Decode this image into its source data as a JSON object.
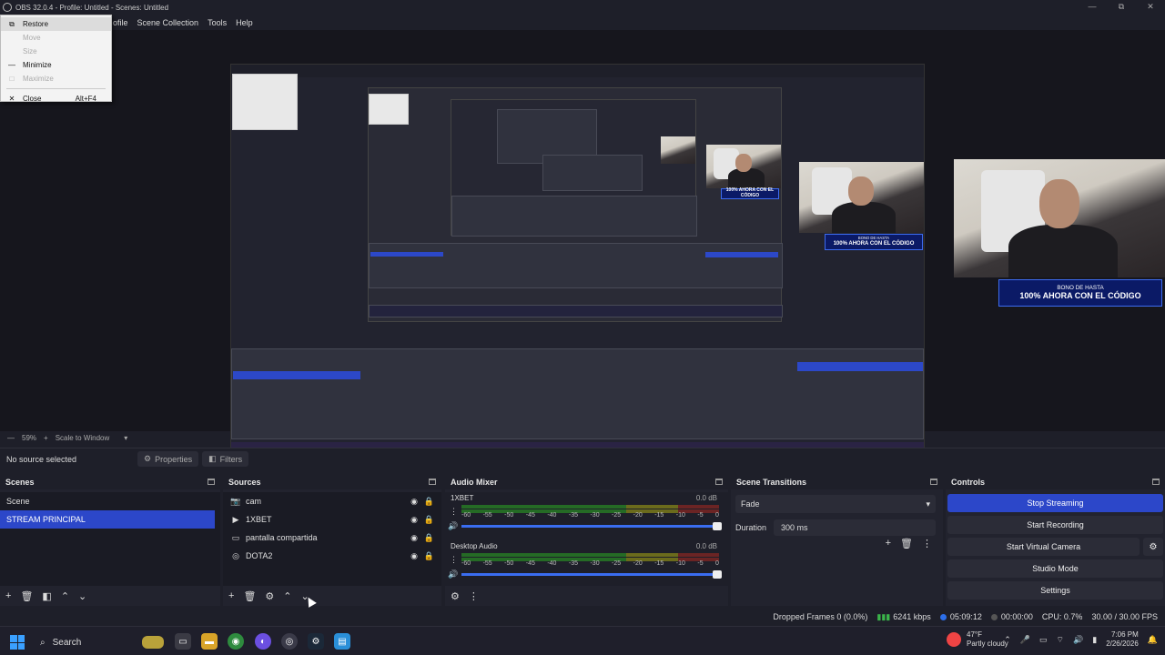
{
  "window": {
    "title": "OBS 32.0.4 - Profile: Untitled - Scenes: Untitled",
    "controls": [
      "minimize-icon",
      "restore-icon",
      "close-icon"
    ]
  },
  "menubar": [
    "ofile",
    "Scene Collection",
    "Tools",
    "Help"
  ],
  "system_menu": {
    "items": [
      {
        "glyph": "⧉",
        "label": "Restore",
        "shortcut": "",
        "disabled": false
      },
      {
        "glyph": "",
        "label": "Move",
        "shortcut": "",
        "disabled": true
      },
      {
        "glyph": "",
        "label": "Size",
        "shortcut": "",
        "disabled": true
      },
      {
        "glyph": "—",
        "label": "Minimize",
        "shortcut": "",
        "disabled": false
      },
      {
        "glyph": "□",
        "label": "Maximize",
        "shortcut": "",
        "disabled": true
      },
      {
        "glyph": "✕",
        "label": "Close",
        "shortcut": "Alt+F4",
        "disabled": false
      }
    ]
  },
  "preview": {
    "banner_line1": "BONO DE HASTA",
    "banner_line2": "100% AHORA CON EL CÓDIGO"
  },
  "scale_bar": {
    "zoom": "59%",
    "mode": "Scale to Window"
  },
  "source_toolbar": {
    "selection": "No source selected",
    "properties": "Properties",
    "filters": "Filters"
  },
  "scenes": {
    "title": "Scenes",
    "items": [
      {
        "label": "Scene",
        "selected": false
      },
      {
        "label": "STREAM PRINCIPAL",
        "selected": true
      }
    ]
  },
  "sources": {
    "title": "Sources",
    "items": [
      {
        "label": "cam",
        "icon": "camera-icon",
        "glyph": "📷"
      },
      {
        "label": "1XBET",
        "icon": "play-icon",
        "glyph": "▶"
      },
      {
        "label": "pantalla compartida",
        "icon": "monitor-icon",
        "glyph": "▭"
      },
      {
        "label": "DOTA2",
        "icon": "gamepad-icon",
        "glyph": "◎"
      }
    ]
  },
  "audio_mixer": {
    "title": "Audio Mixer",
    "ticks": [
      "-60",
      "-55",
      "-50",
      "-45",
      "-40",
      "-35",
      "-30",
      "-25",
      "-20",
      "-15",
      "-10",
      "-5",
      "0"
    ],
    "channels": [
      {
        "name": "1XBET",
        "level": "0.0 dB"
      },
      {
        "name": "Desktop Audio",
        "level": "0.0 dB"
      }
    ]
  },
  "scene_transitions": {
    "title": "Scene Transitions",
    "transition": "Fade",
    "duration_label": "Duration",
    "duration_value": "300 ms"
  },
  "controls": {
    "title": "Controls",
    "stop_streaming": "Stop Streaming",
    "start_recording": "Start Recording",
    "start_virtual_camera": "Start Virtual Camera",
    "studio_mode": "Studio Mode",
    "settings": "Settings"
  },
  "status": {
    "dropped_frames": "Dropped Frames 0 (0.0%)",
    "bitrate": "6241 kbps",
    "stream_time": "05:09:12",
    "rec_time": "00:00:00",
    "cpu": "CPU: 0.7%",
    "fps": "30.00 / 30.00 FPS"
  },
  "taskbar": {
    "search": "Search",
    "weather_temp": "47°F",
    "weather_desc": "Partly cloudy",
    "time": "7:06 PM",
    "date": "2/26/2026"
  },
  "colors": {
    "accent": "#2c47c9",
    "background": "#1e1f29",
    "meter_green": "#256b25",
    "meter_yellow": "#6b6b1c",
    "meter_red": "#6b2424"
  }
}
